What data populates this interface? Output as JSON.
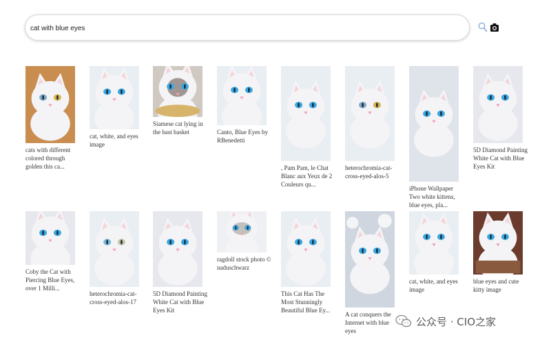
{
  "search": {
    "query": "cat with blue eyes"
  },
  "results": [
    {
      "caption": "cats with different colored through golden this ca...",
      "art": "cat-hetero"
    },
    {
      "caption": "cat, white, and eyes image",
      "art": "cat-face-blue"
    },
    {
      "caption": "Siamese cat lying in the bast basket",
      "art": "cat-siamese"
    },
    {
      "caption": "Canto, Blue Eyes by RBenedetti",
      "art": "cat-close-side"
    },
    {
      "caption": ", Pam Pam, le Chat Blanc aux Yeux de 2 Couleurs qu...",
      "art": "kitten-white"
    },
    {
      "caption": "heterochromia-cat-cross-eyed-alos-5",
      "art": "cat-hetero-2"
    },
    {
      "caption": "iPhone Wallpaper Two white kittens, blue eyes, pla...",
      "art": "two-kittens"
    },
    {
      "caption": "5D Diamond Painting White Cat with Blue Eyes Kit",
      "art": "cat-lying"
    },
    {
      "caption": "Coby the Cat with Piercing Blue Eyes, over 1 Milli...",
      "art": "cat-lying-2"
    },
    {
      "caption": "heterochromia-cat-cross-eyed-alos-17",
      "art": "cat-face-soft"
    },
    {
      "caption": "5D Diamond Painting White Cat with Blue Eyes Kit",
      "art": "cat-lying-3"
    },
    {
      "caption": "ragdoll stock photo © naduschwarz",
      "art": "ragdoll"
    },
    {
      "caption": "This Cat Has The Most Stunningly Beautiful Blue Ey...",
      "art": "cat-face-blue-2"
    },
    {
      "caption": "A cat conquers the Internet with blue eyes",
      "art": "cat-outdoor"
    },
    {
      "caption": "cat, white, and eyes image",
      "art": "cat-face-blue-3"
    },
    {
      "caption": "blue eyes and cute kitty image",
      "art": "kitty-box"
    }
  ],
  "watermark": {
    "text": "公众号 · CIO之家"
  },
  "colors": {
    "fur": "#f4f4f6",
    "eye_blue": "#3aa7e0",
    "nose": "#f2a3b0"
  }
}
